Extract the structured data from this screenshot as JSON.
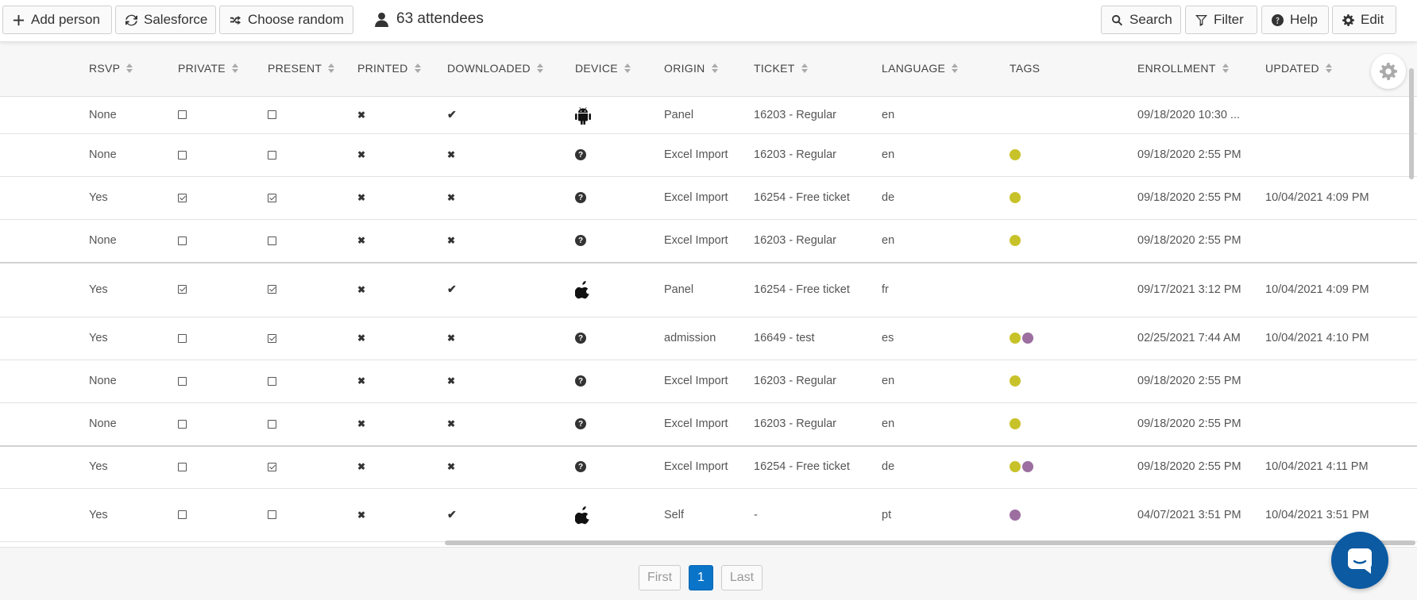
{
  "toolbar": {
    "add_person": "Add person",
    "salesforce": "Salesforce",
    "choose_random": "Choose random",
    "attendee_count": "63 attendees",
    "search": "Search",
    "filter": "Filter",
    "help": "Help",
    "edit": "Edit"
  },
  "columns": [
    "RSVP",
    "PRIVATE",
    "PRESENT",
    "PRINTED",
    "DOWNLOADED",
    "DEVICE",
    "ORIGIN",
    "TICKET",
    "LANGUAGE",
    "TAGS",
    "ENROLLMENT",
    "UPDATED"
  ],
  "colors": {
    "tag_olive": "#c8c22a",
    "tag_purple": "#9c6fa0",
    "accent": "#0a74c9"
  },
  "rows": [
    {
      "rsvp": "None",
      "private": false,
      "present": false,
      "printed": "x",
      "downloaded": "check",
      "device": "android-icon",
      "origin": "Panel",
      "ticket": "16203 - Regular",
      "language": "en",
      "tags": [],
      "enrollment": "09/18/2020 10:30 ...",
      "updated": ""
    },
    {
      "rsvp": "None",
      "private": false,
      "present": false,
      "printed": "x",
      "downloaded": "x",
      "device": "question-icon",
      "origin": "Excel Import",
      "ticket": "16203 - Regular",
      "language": "en",
      "tags": [
        "olive"
      ],
      "enrollment": "09/18/2020 2:55 PM",
      "updated": ""
    },
    {
      "rsvp": "Yes",
      "private": true,
      "present": true,
      "printed": "x",
      "downloaded": "x",
      "device": "question-icon",
      "origin": "Excel Import",
      "ticket": "16254 - Free ticket",
      "language": "de",
      "tags": [
        "olive"
      ],
      "enrollment": "09/18/2020 2:55 PM",
      "updated": "10/04/2021 4:09 PM"
    },
    {
      "rsvp": "None",
      "private": false,
      "present": false,
      "printed": "x",
      "downloaded": "x",
      "device": "question-icon",
      "origin": "Excel Import",
      "ticket": "16203 - Regular",
      "language": "en",
      "tags": [
        "olive"
      ],
      "enrollment": "09/18/2020 2:55 PM",
      "updated": ""
    },
    {
      "rsvp": "Yes",
      "private": true,
      "present": true,
      "printed": "x",
      "downloaded": "check",
      "device": "apple-icon",
      "origin": "Panel",
      "ticket": "16254 - Free ticket",
      "language": "fr",
      "tags": [],
      "enrollment": "09/17/2021 3:12 PM",
      "updated": "10/04/2021 4:09 PM"
    },
    {
      "rsvp": "Yes",
      "private": false,
      "present": true,
      "printed": "x",
      "downloaded": "x",
      "device": "question-icon",
      "origin": "admission",
      "ticket": "16649 - test",
      "language": "es",
      "tags": [
        "olive",
        "purple"
      ],
      "enrollment": "02/25/2021 7:44 AM",
      "updated": "10/04/2021 4:10 PM"
    },
    {
      "rsvp": "None",
      "private": false,
      "present": false,
      "printed": "x",
      "downloaded": "x",
      "device": "question-icon",
      "origin": "Excel Import",
      "ticket": "16203 - Regular",
      "language": "en",
      "tags": [
        "olive"
      ],
      "enrollment": "09/18/2020 2:55 PM",
      "updated": ""
    },
    {
      "rsvp": "None",
      "private": false,
      "present": false,
      "printed": "x",
      "downloaded": "x",
      "device": "question-icon",
      "origin": "Excel Import",
      "ticket": "16203 - Regular",
      "language": "en",
      "tags": [
        "olive"
      ],
      "enrollment": "09/18/2020 2:55 PM",
      "updated": ""
    },
    {
      "rsvp": "Yes",
      "private": false,
      "present": true,
      "printed": "x",
      "downloaded": "x",
      "device": "question-icon",
      "origin": "Excel Import",
      "ticket": "16254 - Free ticket",
      "language": "de",
      "tags": [
        "olive",
        "purple"
      ],
      "enrollment": "09/18/2020 2:55 PM",
      "updated": "10/04/2021 4:11 PM"
    },
    {
      "rsvp": "Yes",
      "private": false,
      "present": false,
      "printed": "x",
      "downloaded": "check",
      "device": "apple-icon",
      "origin": "Self",
      "ticket": "-",
      "language": "pt",
      "tags": [
        "purple"
      ],
      "enrollment": "04/07/2021 3:51 PM",
      "updated": "10/04/2021 3:51 PM"
    }
  ],
  "pager": {
    "first": "First",
    "current": "1",
    "last": "Last"
  }
}
